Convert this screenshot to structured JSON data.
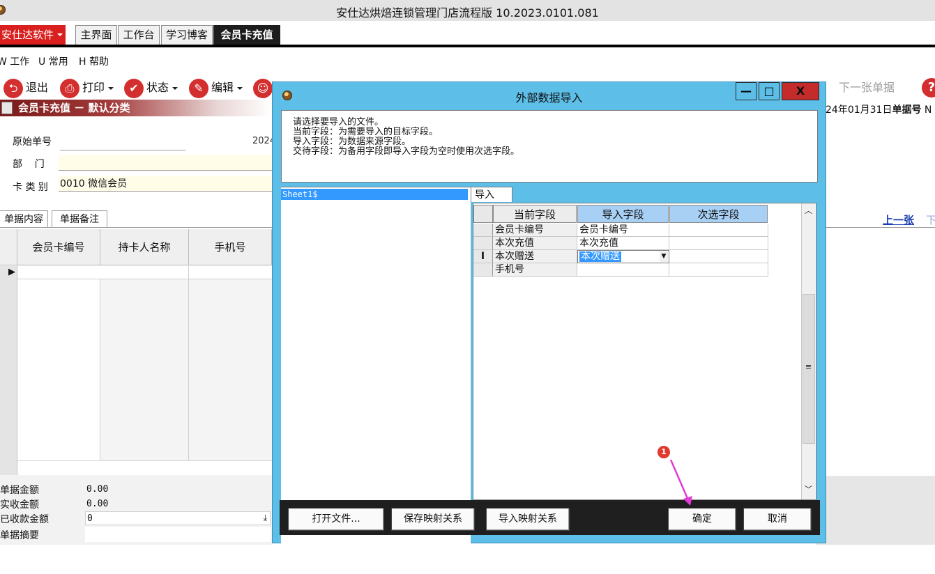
{
  "window": {
    "title": "安仕达烘焙连锁管理门店流程版   10.2023.0101.081"
  },
  "top_tabs": {
    "brand": "安仕达软件",
    "home": "主界面",
    "workbench": "工作台",
    "blog": "学习博客",
    "active": "会员卡充值"
  },
  "menu": {
    "work": "W 工作",
    "common": "U 常用",
    "help": "H 帮助"
  },
  "toolbar": {
    "exit": "退出",
    "print": "打印",
    "status": "状态",
    "edit": "编辑",
    "next_doc": "下一张单据"
  },
  "section": {
    "title": "会员卡充值 － 默认分类",
    "doc_date": "24年01月31日",
    "doc_no_label": "单据号",
    "doc_no_cut": "N"
  },
  "form": {
    "orig_no_label": "原始单号",
    "orig_no_value": "",
    "date_partial": "2024",
    "dept_label": "部    门",
    "dept_value": "",
    "cardtype_label": "卡 类 别",
    "cardtype_value": "0010 微信会员"
  },
  "subtabs": {
    "content": "单据内容",
    "note": "单据备注"
  },
  "nav": {
    "prev": "上一张",
    "next_cut": "下"
  },
  "grid": {
    "columns": [
      "会员卡编号",
      "持卡人名称",
      "手机号"
    ],
    "row_marker": "▶"
  },
  "summary": [
    {
      "label": "单据金额",
      "value": "0.00"
    },
    {
      "label": "实收金额",
      "value": "0.00"
    },
    {
      "label": "已收款金额",
      "value": "0"
    },
    {
      "label": "单据摘要",
      "value": ""
    }
  ],
  "dialog": {
    "title": "外部数据导入",
    "min": "—",
    "max": "□",
    "close": "X",
    "instructions": [
      "请选择要导入的文件。",
      "当前字段：为需要导入的目标字段。",
      "导入字段：为数据来源字段。",
      "交待字段：为备用字段即导入字段为空时使用次选字段。"
    ],
    "sheet": "Sheet1$",
    "tab": "导入",
    "map_headers": [
      "当前字段",
      "导入字段",
      "次选字段"
    ],
    "map_rows": [
      {
        "current": "会员卡编号",
        "import": "会员卡编号",
        "alt": ""
      },
      {
        "current": "本次充值",
        "import": "本次充值",
        "alt": ""
      },
      {
        "current": "本次赠送",
        "import": "本次赠送",
        "alt": ""
      },
      {
        "current": "手机号",
        "import": "",
        "alt": ""
      }
    ],
    "row_cursor": "I",
    "buttons": {
      "open": "打开文件...",
      "save": "保存映射关系",
      "load": "导入映射关系",
      "ok": "确定",
      "cancel": "取消"
    }
  },
  "annotation": {
    "marker": "1",
    "color": "#e23bd6"
  }
}
